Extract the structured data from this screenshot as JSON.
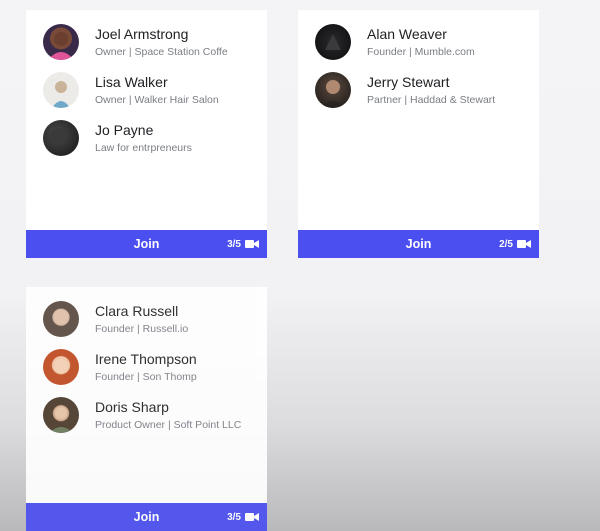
{
  "cards": [
    {
      "members": [
        {
          "name": "Joel Armstrong",
          "subtitle": "Owner | Space Station Coffe",
          "avatar_color": "#5b3a2e"
        },
        {
          "name": "Lisa Walker",
          "subtitle": "Owner | Walker Hair Salon",
          "avatar_color": "#d9d4cc"
        },
        {
          "name": "Jo Payne",
          "subtitle": "Law for entrpreneurs",
          "avatar_color": "#2a2a2a"
        }
      ],
      "join_label": "Join",
      "count": "3/5",
      "icon": "video-camera-icon"
    },
    {
      "members": [
        {
          "name": "Alan Weaver",
          "subtitle": "Founder | Mumble.com",
          "avatar_color": "#1c1c1e"
        },
        {
          "name": "Jerry Stewart",
          "subtitle": "Partner | Haddad & Stewart",
          "avatar_color": "#3a2f2a"
        }
      ],
      "join_label": "Join",
      "count": "2/5",
      "icon": "video-camera-icon"
    },
    {
      "members": [
        {
          "name": "Clara Russell",
          "subtitle": "Founder | Russell.io",
          "avatar_color": "#8a6a5a"
        },
        {
          "name": "Irene Thompson",
          "subtitle": "Founder | Son Thomp",
          "avatar_color": "#c0502a"
        },
        {
          "name": "Doris Sharp",
          "subtitle": "Product Owner | Soft Point LLC",
          "avatar_color": "#6a5a4a"
        }
      ],
      "join_label": "Join",
      "count": "3/5",
      "icon": "video-camera-icon"
    }
  ],
  "colors": {
    "join_bar": "#4b4ff0",
    "name_text": "#202124",
    "subtitle_text": "#7a7d84"
  }
}
